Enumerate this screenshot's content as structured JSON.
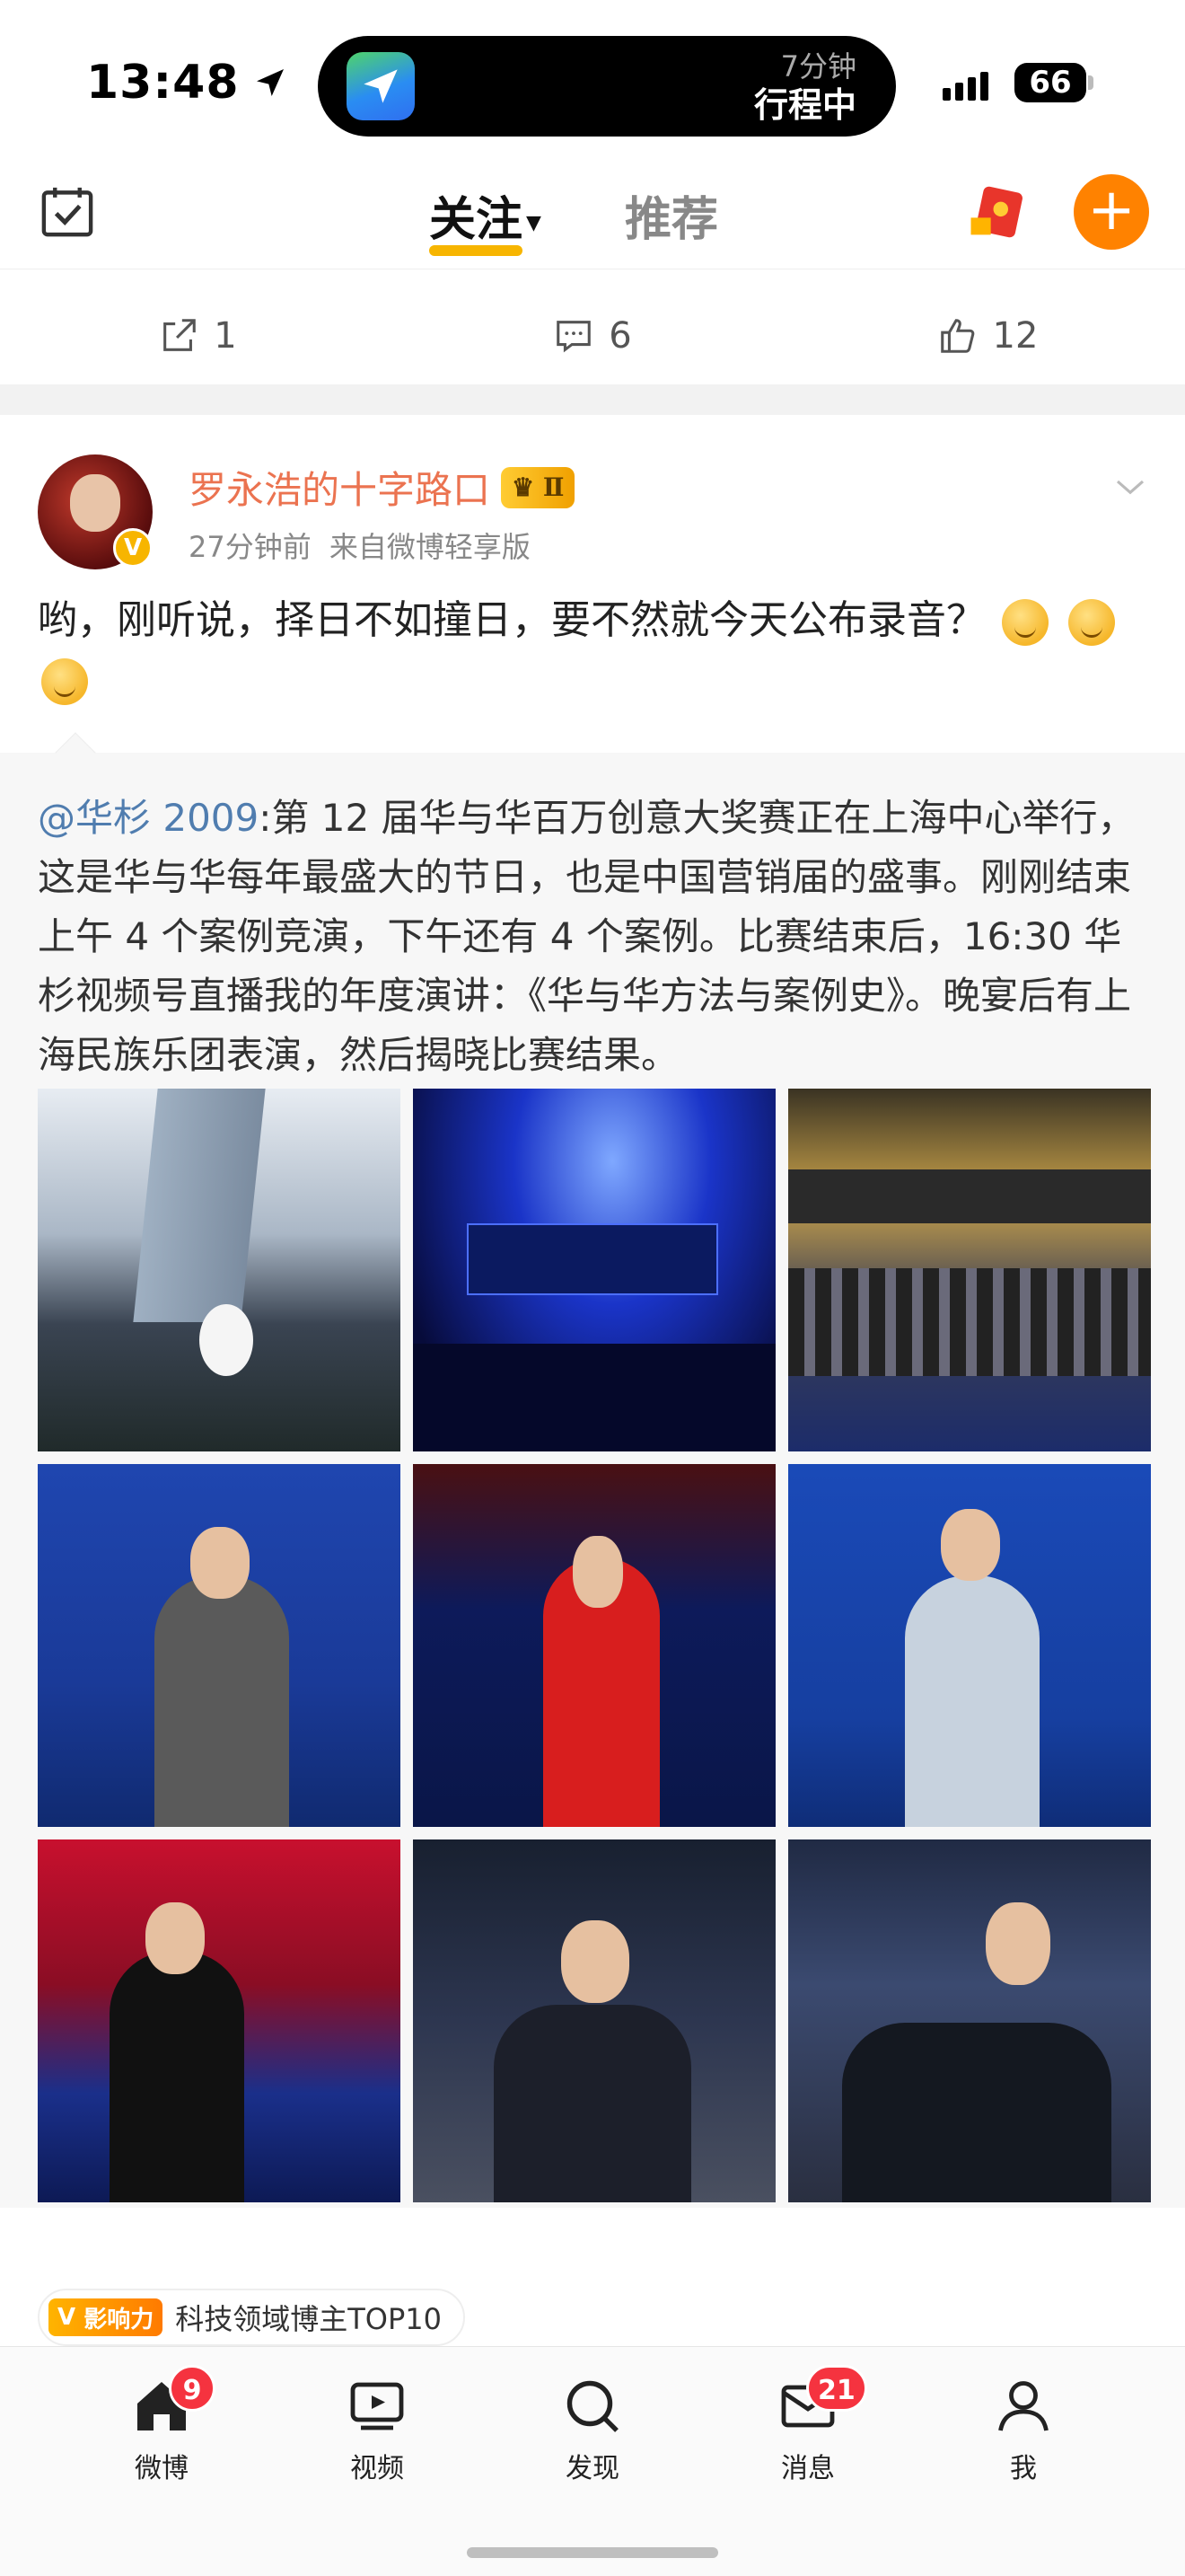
{
  "status_bar": {
    "time": "13:48",
    "island_eta_small": "7分钟",
    "island_eta_big": "行程中",
    "battery": "66"
  },
  "top_nav": {
    "tab_follow": "关注",
    "tab_recommend": "推荐"
  },
  "previous_post_actions": {
    "repost_count": "1",
    "comment_count": "6",
    "like_count": "12"
  },
  "post": {
    "username": "罗永浩的十字路口",
    "vip_level": "Ⅱ",
    "time": "27分钟前",
    "source": "来自微博轻享版",
    "text": "哟，刚听说，择日不如撞日，要不然就今天公布录音？",
    "emoji_count": 3,
    "repost": {
      "mention": "@华杉 2009",
      "text": ":第 12 届华与华百万创意大奖赛正在上海中心举行，这是华与华每年最盛大的节日，也是中国营销届的盛事。刚刚结束上午 4 个案例竞演，下午还有 4 个案例。比赛结束后，16:30 华杉视频号直播我的年度演讲：《华与华方法与案例史》。晚宴后有上海民族乐团表演，然后揭晓比赛结果。"
    },
    "photos": [
      "photo-building",
      "photo-stage-blue",
      "photo-audience",
      "photo-speaker-woman-grey",
      "photo-speaker-man-red",
      "photo-speaker-woman-white",
      "photo-speaker-woman-black",
      "photo-guest-man-blue-tie",
      "photo-guests-seated"
    ]
  },
  "influence": {
    "badge": "影响力",
    "label": "科技领域博主TOP10"
  },
  "tab_bar": {
    "items": [
      {
        "label": "微博",
        "badge": "9"
      },
      {
        "label": "视频",
        "badge": ""
      },
      {
        "label": "发现",
        "badge": ""
      },
      {
        "label": "消息",
        "badge": "21"
      },
      {
        "label": "我",
        "badge": ""
      }
    ]
  },
  "colors": {
    "accent_orange": "#ff8200",
    "username": "#eb7350",
    "mention": "#507daf",
    "badge_red": "#f5333f",
    "tab_underline": "#f7b500"
  }
}
